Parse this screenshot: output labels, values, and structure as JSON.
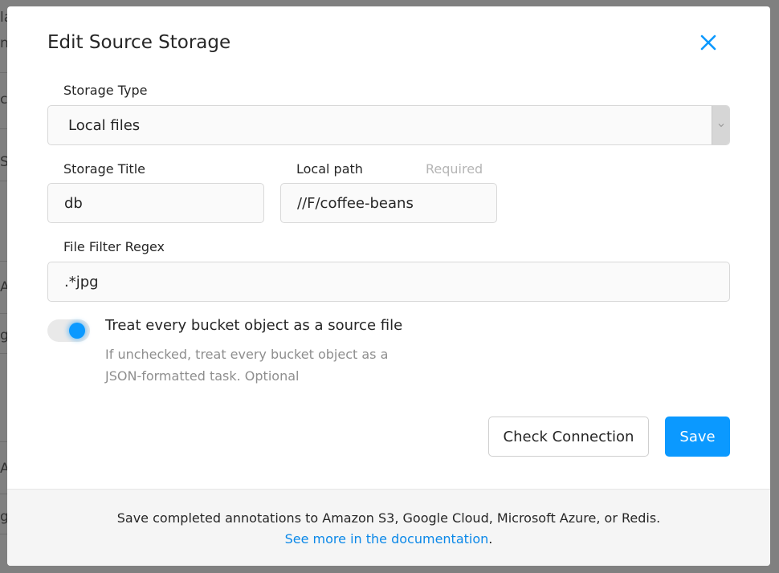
{
  "backdrop": {
    "fragments": [
      "la",
      "n",
      "c",
      "S",
      "A",
      "g",
      "A",
      "g"
    ]
  },
  "modal": {
    "title": "Edit Source Storage",
    "close_icon": "close-icon"
  },
  "form": {
    "storage_type": {
      "label": "Storage Type",
      "value": "Local files"
    },
    "storage_title": {
      "label": "Storage Title",
      "value": "db"
    },
    "local_path": {
      "label": "Local path",
      "hint": "Required",
      "value": "//F/coffee-beans"
    },
    "file_filter_regex": {
      "label": "File Filter Regex",
      "value": ".*jpg"
    },
    "treat_as_source": {
      "label": "Treat every bucket object as a source file",
      "description": "If unchecked, treat every bucket object as a JSON-formatted task. Optional",
      "checked": true
    }
  },
  "actions": {
    "check_connection_label": "Check Connection",
    "save_label": "Save"
  },
  "footer": {
    "text": "Save completed annotations to Amazon S3, Google Cloud, Microsoft Azure, or Redis.",
    "link_text": "See more in the documentation",
    "link_suffix": "."
  },
  "colors": {
    "accent": "#0b99ff",
    "link": "#0b88e8",
    "backdrop": "#808080"
  }
}
